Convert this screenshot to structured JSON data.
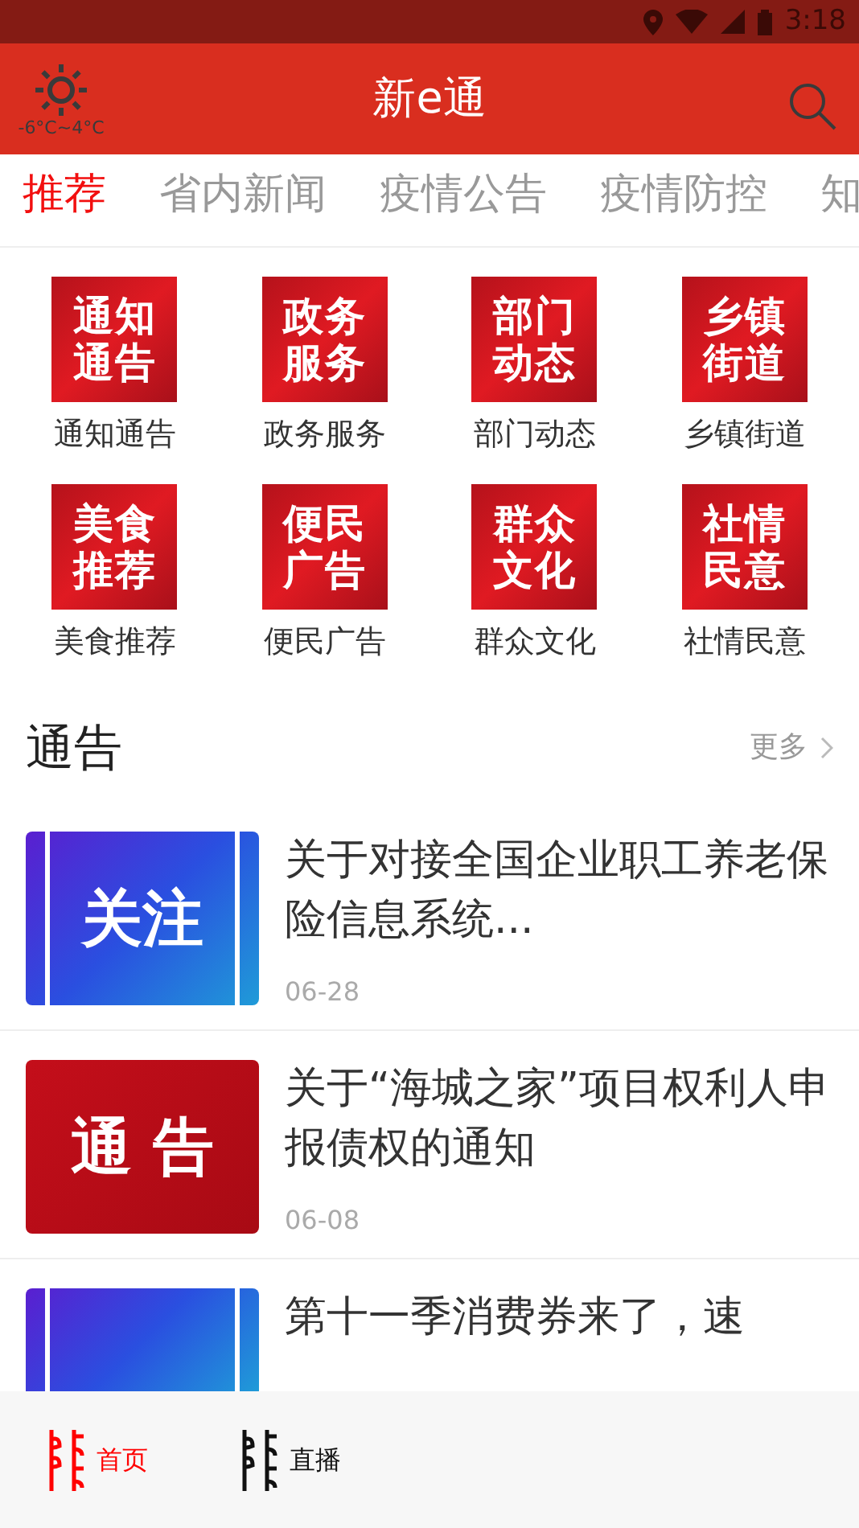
{
  "status_bar": {
    "time": "3:18"
  },
  "header": {
    "weather": "-6°C~4°C",
    "title": "新e通"
  },
  "tabs": [
    {
      "label": "推荐",
      "selected": true
    },
    {
      "label": "省内新闻",
      "selected": false
    },
    {
      "label": "疫情公告",
      "selected": false
    },
    {
      "label": "疫情防控",
      "selected": false
    },
    {
      "label": "知",
      "selected": false
    }
  ],
  "categories": [
    {
      "tile": [
        "通知",
        "通告"
      ],
      "label": "通知通告"
    },
    {
      "tile": [
        "政务",
        "服务"
      ],
      "label": "政务服务"
    },
    {
      "tile": [
        "部门",
        "动态"
      ],
      "label": "部门动态"
    },
    {
      "tile": [
        "乡镇",
        "街道"
      ],
      "label": "乡镇街道"
    },
    {
      "tile": [
        "美食",
        "推荐"
      ],
      "label": "美食推荐"
    },
    {
      "tile": [
        "便民",
        "广告"
      ],
      "label": "便民广告"
    },
    {
      "tile": [
        "群众",
        "文化"
      ],
      "label": "群众文化"
    },
    {
      "tile": [
        "社情",
        "民意"
      ],
      "label": "社情民意"
    }
  ],
  "section": {
    "title": "通告",
    "more": "更多"
  },
  "news": [
    {
      "thumb": "关注",
      "kind": "blue",
      "title": "关于对接全国企业职工养老保险信息系统...",
      "date": "06-28"
    },
    {
      "thumb": "通 告",
      "kind": "red",
      "title": "关于“海城之家”项目权利人申报债权的通知",
      "date": "06-08"
    },
    {
      "kind": "blue",
      "title": "第十一季消费券来了，速"
    }
  ],
  "bottom_nav": [
    {
      "label": "首页",
      "selected": true
    },
    {
      "label": "直播",
      "selected": false
    }
  ]
}
